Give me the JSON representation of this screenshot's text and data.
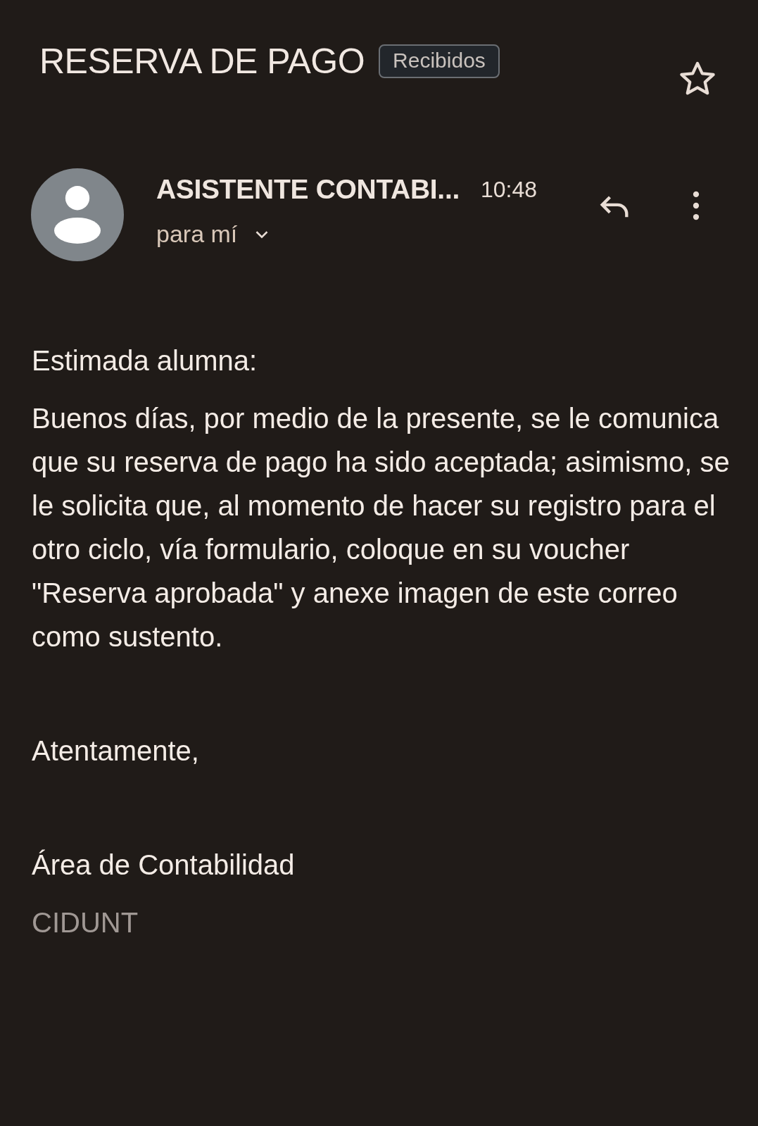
{
  "subject": "RESERVA DE PAGO",
  "label": "Recibidos",
  "starred": false,
  "message": {
    "sender": "ASISTENTE CONTABI...",
    "time": "10:48",
    "recipient": "para mí"
  },
  "body": [
    {
      "kind": "text",
      "text": "Estimada alumna:"
    },
    {
      "kind": "text",
      "text": "Buenos días, por medio de la presente, se le comunica que su reserva de pago ha sido aceptada; asimismo, se le solicita que, al momento de hacer su registro para el otro ciclo, vía formulario, coloque en su voucher \"Reserva aprobada\" y anexe imagen de este correo como sustento."
    },
    {
      "kind": "gap"
    },
    {
      "kind": "text",
      "text": "Atentamente,"
    },
    {
      "kind": "gap"
    },
    {
      "kind": "text",
      "text": "Área de Contabilidad"
    },
    {
      "kind": "muted",
      "text": "CIDUNT"
    }
  ]
}
